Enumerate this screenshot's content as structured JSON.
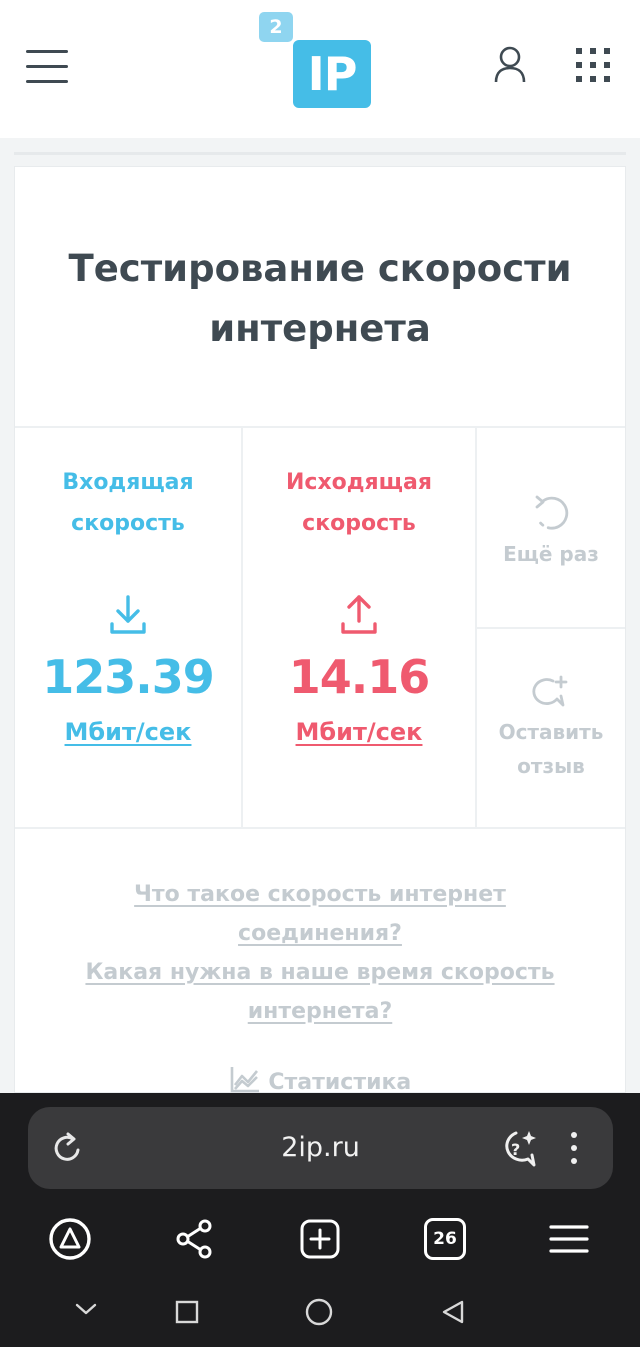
{
  "header": {
    "logo_small": "2",
    "logo_big": "IP"
  },
  "card": {
    "title_line1": "Тестирование скорости",
    "title_line2": "интернета",
    "download": {
      "label_line1": "Входящая",
      "label_line2": "скорость",
      "value": "123.39",
      "unit": "Мбит/сек"
    },
    "upload": {
      "label_line1": "Исходящая",
      "label_line2": "скорость",
      "value": "14.16",
      "unit": "Мбит/сек"
    },
    "retry_label": "Ещё раз",
    "feedback_label_line1": "Оставить",
    "feedback_label_line2": "отзыв",
    "faq": {
      "q1_line1": "Что такое скорость интернет",
      "q1_line2": "соединения?",
      "q2_line1": "Какая нужна в наше время скорость",
      "q2_line2": "интернета?"
    },
    "stats_label": "Статистика"
  },
  "browser": {
    "url": "2ip.ru",
    "tabs_count": "26"
  },
  "colors": {
    "download": "#45bde7",
    "upload": "#ef5a6f",
    "muted": "#c4cbd0"
  }
}
